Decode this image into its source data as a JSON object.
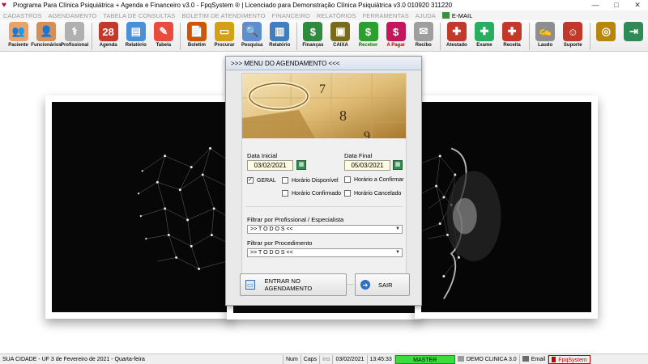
{
  "window": {
    "title": "Programa Para Clínica Psiquiátrica + Agenda e Financeiro v3.0 - FpqSystem ® | Licenciado para  Demonstração Clínica Psiquiátrica v3.0 010920 311220",
    "controls": [
      "—",
      "□",
      "✕"
    ]
  },
  "menu": {
    "items": [
      "CADASTROS",
      "AGENDAMENTO",
      "TABELA DE CONSULTAS",
      "BOLETIM DE ATENDIMENTO",
      "FINANCEIRO",
      "RELATÓRIOS",
      "FERRAMENTAS",
      "AJUDA"
    ],
    "email": "E-MAIL"
  },
  "toolbar": {
    "items": [
      {
        "label": "Paciente",
        "icon": "people-icon",
        "color": "#e8a36a",
        "glyph": "👥"
      },
      {
        "label": "Funcionários",
        "icon": "staff-icon",
        "color": "#d48e58",
        "glyph": "👤"
      },
      {
        "label": "Profissional",
        "icon": "doctor-icon",
        "color": "#b0b0b0",
        "glyph": "⚕"
      },
      {
        "label": "Agenda",
        "icon": "calendar-icon",
        "color": "#c0392b",
        "glyph": "28"
      },
      {
        "label": "Relatório",
        "icon": "report-icon",
        "color": "#4a90d9",
        "glyph": "▤"
      },
      {
        "label": "Tabela",
        "icon": "table-icon",
        "color": "#e74c3c",
        "glyph": "✎"
      },
      {
        "label": "Boletim",
        "icon": "bulletin-icon",
        "color": "#d35400",
        "glyph": "📄"
      },
      {
        "label": "Procurar",
        "icon": "folder-icon",
        "color": "#d4a017",
        "glyph": "▭"
      },
      {
        "label": "Pesquisa",
        "icon": "search-icon",
        "color": "#5d8fcf",
        "glyph": "🔍"
      },
      {
        "label": "Relatório",
        "icon": "report2-icon",
        "color": "#3f7fbf",
        "glyph": "▥"
      },
      {
        "label": "Finanças",
        "icon": "finance-icon",
        "color": "#2e8b3d",
        "glyph": "$"
      },
      {
        "label": "CAIXA",
        "icon": "cash-icon",
        "color": "#7a6a1c",
        "glyph": "▣"
      },
      {
        "label": "Receber",
        "icon": "receive-icon",
        "color": "#2ca02c",
        "glyph": "$",
        "accent": "green"
      },
      {
        "label": "A Pagar",
        "icon": "pay-icon",
        "color": "#c2185b",
        "glyph": "$",
        "accent": "red"
      },
      {
        "label": "Recibo",
        "icon": "receipt-icon",
        "color": "#9e9e9e",
        "glyph": "✉"
      },
      {
        "label": "Atestado",
        "icon": "certificate-icon",
        "color": "#c0392b",
        "glyph": "✚"
      },
      {
        "label": "Exame",
        "icon": "exam-icon",
        "color": "#27ae60",
        "glyph": "✚"
      },
      {
        "label": "Receita",
        "icon": "prescription-icon",
        "color": "#c0392b",
        "glyph": "✚"
      },
      {
        "label": "Laudo",
        "icon": "report-doc-icon",
        "color": "#8e8e8e",
        "glyph": "✍"
      },
      {
        "label": "Suporte",
        "icon": "support-icon",
        "color": "#c0392b",
        "glyph": "☺"
      },
      {
        "label": "",
        "icon": "coins-icon",
        "color": "#b8860b",
        "glyph": "◎"
      },
      {
        "label": "",
        "icon": "exit-icon",
        "color": "#2e8b57",
        "glyph": "⇥"
      }
    ]
  },
  "dialog": {
    "title": ">>>  MENU DO AGENDAMENTO  <<<",
    "start_label": "Data Inicial",
    "start_date": "03/02/2021",
    "end_label": "Data Final",
    "end_date": "05/03/2021",
    "checks": {
      "geral": {
        "label": "GERAL",
        "checked": true
      },
      "disponivel": {
        "label": "Horário  Disponível",
        "checked": false
      },
      "confirmado": {
        "label": "Horário Confirmado",
        "checked": false
      },
      "a_confirmar": {
        "label": "Horário a Confirmar",
        "checked": false
      },
      "cancelado": {
        "label": "Horário Cancelado",
        "checked": false
      }
    },
    "filter_prof_label": "Filtrar por Profissional / Especialista",
    "filter_prof_value": ">> T O D O S <<",
    "filter_proc_label": "Filtrar por Procedimento",
    "filter_proc_value": ">> T O D O S <<",
    "enter_button": "ENTRAR NO AGENDAMENTO",
    "exit_button": "SAIR"
  },
  "status": {
    "city": "SUA CIDADE - UF  3 de Fevereiro de 2021 - Quarta-feira",
    "num": "Num",
    "caps": "Caps",
    "ins": "Ins",
    "date": "03/02/2021",
    "time": "13:45:33",
    "user": "MASTER",
    "company": "DEMO CLINICA 3.0",
    "email": "Email",
    "brand": "FpqSystem"
  },
  "colors": {
    "master_bg": "#3cdc3c",
    "date_bg": "#fffde0",
    "calendar_btn": "#2f8f4f",
    "brand_red": "#c00000"
  }
}
